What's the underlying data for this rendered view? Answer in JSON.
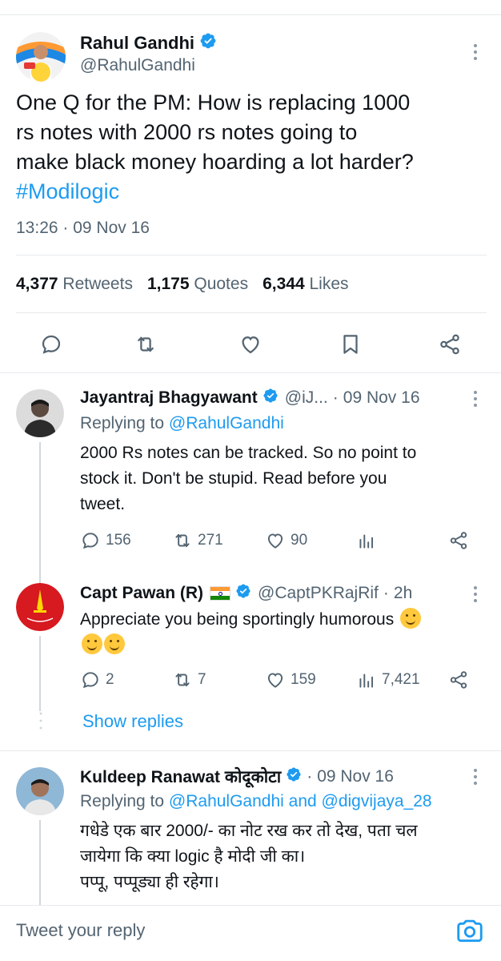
{
  "main_tweet": {
    "name": "Rahul Gandhi",
    "handle": "@RahulGandhi",
    "text_line1": "One Q for the PM: How is replacing 1000",
    "text_line2": "rs notes with 2000 rs notes going to",
    "text_line3": "make black money hoarding a lot harder?",
    "hashtag": "#Modilogic",
    "timestamp": "13:26 · 09 Nov 16",
    "retweets_count": "4,377",
    "retweets_label": "Retweets",
    "quotes_count": "1,175",
    "quotes_label": "Quotes",
    "likes_count": "6,344",
    "likes_label": "Likes",
    "actions": [
      "reply-icon",
      "retweet-icon",
      "like-icon",
      "bookmark-icon",
      "share-icon"
    ]
  },
  "replies": [
    {
      "name": "Jayantraj Bhagyawant",
      "handle": "@iJ...",
      "dot": "·",
      "date": "09 Nov 16",
      "replying_prefix": "Replying to",
      "replying_to": "@RahulGandhi",
      "text_line1": "2000  Rs notes can be tracked. So no point to",
      "text_line2": "stock it. Don't be stupid. Read before you",
      "text_line3": "tweet.",
      "reply_count": "156",
      "retweet_count": "271",
      "like_count": "90",
      "views_count": ""
    },
    {
      "name": "Capt Pawan (R)",
      "handle": "@CaptPKRajRif",
      "dot": "·",
      "date": "2h",
      "text_line1": "Appreciate you being sportingly humorous",
      "reply_count": "2",
      "retweet_count": "7",
      "like_count": "159",
      "views_count": "7,421"
    },
    {
      "name": "Kuldeep Ranawat कोदूकोटा",
      "handle": "",
      "dot": "·",
      "date": "09 Nov 16",
      "replying_prefix": "Replying to",
      "replying_to": "@RahulGandhi and @digvijaya_28",
      "text_line1": "गधेडे एक बार 2000/- का नोट रख कर तो देख, पता चल",
      "text_line2": "जायेगा कि क्या logic है मोदी जी का।",
      "text_line3": "पप्पू, पप्पूड्या ही रहेगा।"
    }
  ],
  "show_replies_label": "Show replies",
  "compose": {
    "placeholder": "Tweet your reply"
  },
  "colors": {
    "accent": "#1d9bf0",
    "secondary_text": "#536471",
    "primary_text": "#0f1419",
    "divider": "#e6e9ec"
  }
}
